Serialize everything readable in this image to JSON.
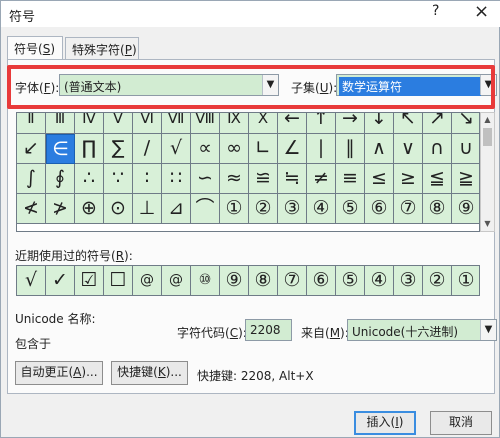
{
  "window": {
    "title": "符号",
    "help": "?",
    "close": "×"
  },
  "tabs": [
    {
      "label": "符号(",
      "key": "S",
      "suffix": ")"
    },
    {
      "label": "特殊字符(",
      "key": "P",
      "suffix": ")"
    }
  ],
  "font": {
    "label": "字体(",
    "key": "F",
    "suffix": "):",
    "value": "(普通文本)"
  },
  "subset": {
    "label": "子集(",
    "key": "U",
    "suffix": "):",
    "value": "数学运算符"
  },
  "symbol_grid": {
    "rows": [
      [
        "Ⅱ",
        "Ⅲ",
        "Ⅳ",
        "Ⅴ",
        "Ⅵ",
        "Ⅶ",
        "Ⅷ",
        "Ⅸ",
        "Ⅹ",
        "←",
        "↑",
        "→",
        "↓",
        "↖",
        "↗",
        "↘"
      ],
      [
        "↙",
        "∈",
        "∏",
        "∑",
        "∕",
        "√",
        "∝",
        "∞",
        "∟",
        "∠",
        "∣",
        "∥",
        "∧",
        "∨",
        "∩",
        "∪"
      ],
      [
        "∫",
        "∮",
        "∴",
        "∵",
        "∶",
        "∷",
        "∽",
        "≈",
        "≌",
        "≒",
        "≠",
        "≡",
        "≤",
        "≥",
        "≦",
        "≧"
      ],
      [
        "≮",
        "≯",
        "⊕",
        "⊙",
        "⊥",
        "⊿",
        "⌒",
        "①",
        "②",
        "③",
        "④",
        "⑤",
        "⑥",
        "⑦",
        "⑧",
        "⑨"
      ]
    ],
    "selected": "∈"
  },
  "recent": {
    "label": "近期使用过的符号(",
    "key": "R",
    "suffix": "):",
    "symbols": [
      "√",
      "✓",
      "☑",
      "☐",
      "@",
      "@",
      "⑩",
      "⑨",
      "⑧",
      "⑦",
      "⑥",
      "⑤",
      "④",
      "③",
      "②",
      "①"
    ]
  },
  "unicode_name_label": "Unicode 名称:",
  "contains_label": "包含于",
  "char_code": {
    "label": "字符代码(",
    "key": "C",
    "suffix": "):",
    "value": "2208"
  },
  "from": {
    "label": "来自(",
    "key": "M",
    "suffix": "):",
    "value": "Unicode(十六进制)"
  },
  "buttons": {
    "autocorrect": {
      "label": "自动更正(",
      "key": "A",
      "suffix": ")..."
    },
    "shortcut": {
      "label": "快捷键(",
      "key": "K",
      "suffix": ")..."
    },
    "insert": {
      "label": "插入(",
      "key": "I",
      "suffix": ")"
    },
    "cancel": "取消"
  },
  "shortcut_text": "快捷键: 2208, Alt+X",
  "colors": {
    "cell_bg": "#d8f0d8",
    "selected_bg": "#2b7de0",
    "highlight_border": "#e83a3a"
  }
}
